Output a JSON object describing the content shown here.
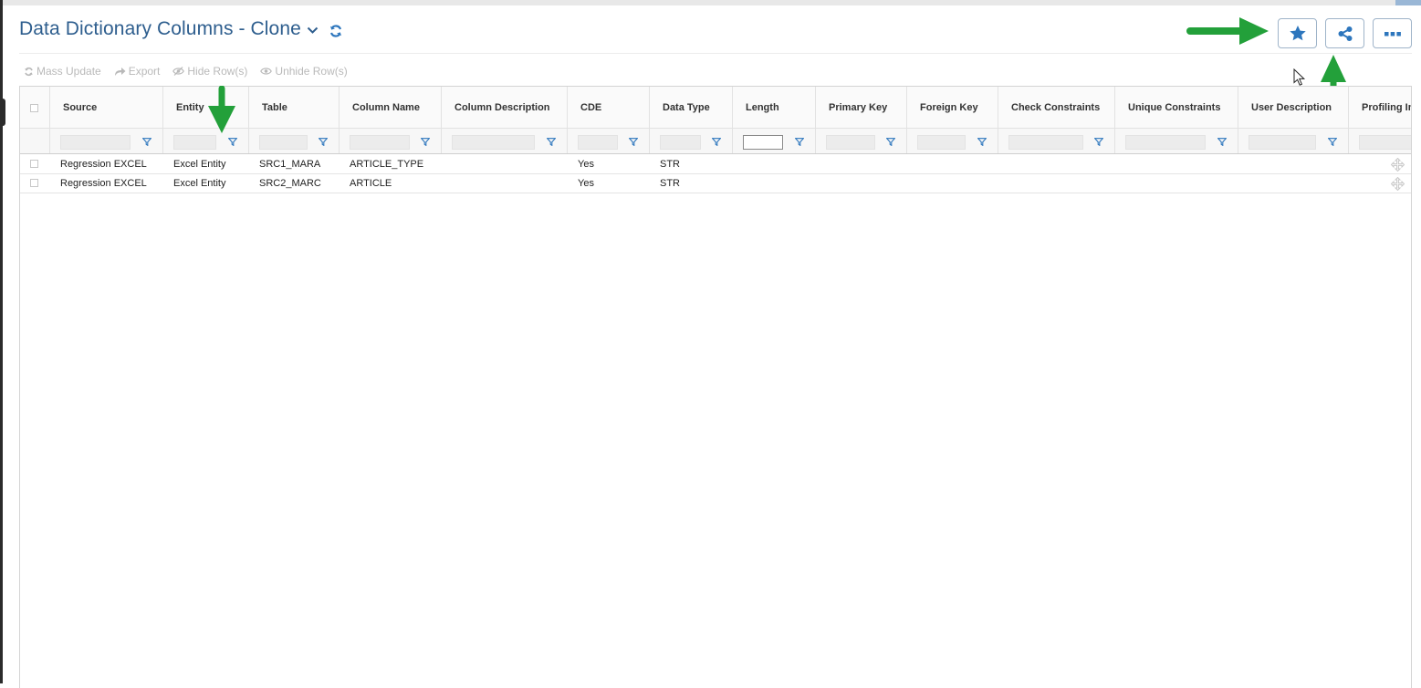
{
  "header": {
    "title": "Data Dictionary Columns - Clone",
    "chevron_icon": "chevron-down-icon",
    "refresh_icon": "refresh-icon"
  },
  "toolbar": {
    "mass_update": "Mass Update",
    "export": "Export",
    "hide_rows": "Hide Row(s)",
    "unhide_rows": "Unhide Row(s)"
  },
  "actions": {
    "favorite_icon": "star-icon",
    "share_icon": "share-icon",
    "more_icon": "more-icon"
  },
  "grid": {
    "columns": [
      {
        "key": "source",
        "label": "Source"
      },
      {
        "key": "entity",
        "label": "Entity"
      },
      {
        "key": "table",
        "label": "Table"
      },
      {
        "key": "column_name",
        "label": "Column Name"
      },
      {
        "key": "column_description",
        "label": "Column Description"
      },
      {
        "key": "cde",
        "label": "CDE"
      },
      {
        "key": "data_type",
        "label": "Data Type"
      },
      {
        "key": "length",
        "label": "Length"
      },
      {
        "key": "primary_key",
        "label": "Primary Key"
      },
      {
        "key": "foreign_key",
        "label": "Foreign Key"
      },
      {
        "key": "check_constraints",
        "label": "Check Constraints"
      },
      {
        "key": "unique_constraints",
        "label": "Unique Constraints"
      },
      {
        "key": "user_description",
        "label": "User Description"
      },
      {
        "key": "profiling_info",
        "label": "Profiling Inf"
      }
    ],
    "rows": [
      {
        "source": "Regression EXCEL",
        "entity": "Excel Entity",
        "table": "SRC1_MARA",
        "column_name": "ARTICLE_TYPE",
        "column_description": "",
        "cde": "Yes",
        "data_type": "STR"
      },
      {
        "source": "Regression EXCEL",
        "entity": "Excel Entity",
        "table": "SRC2_MARC",
        "column_name": "ARTICLE",
        "column_description": "",
        "cde": "Yes",
        "data_type": "STR"
      }
    ]
  },
  "colors": {
    "title": "#2e5e8e",
    "accent": "#2d76bd",
    "toolbar_disabled": "#b9b9b9",
    "annotation_arrow": "#23a03a"
  }
}
